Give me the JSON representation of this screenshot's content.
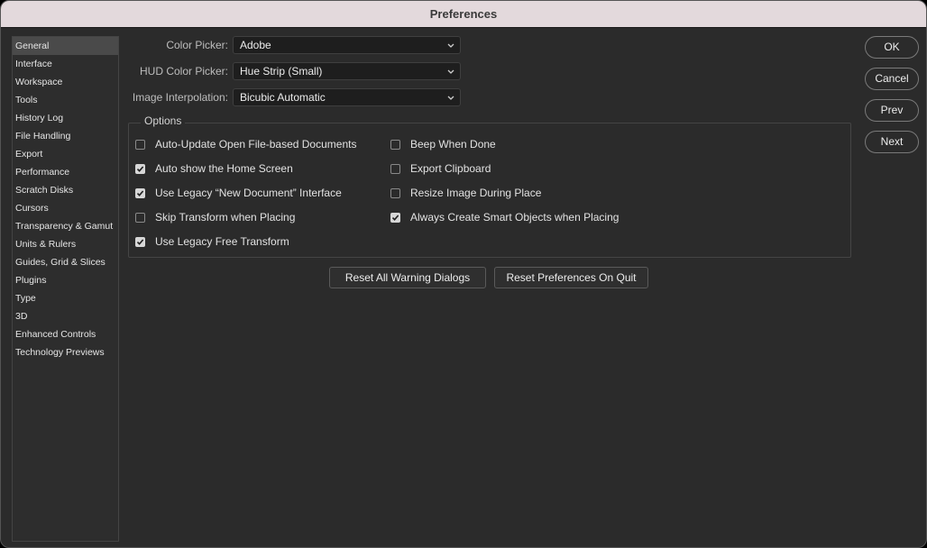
{
  "window": {
    "title": "Preferences"
  },
  "sidebar": {
    "items": [
      {
        "label": "General",
        "selected": true
      },
      {
        "label": "Interface"
      },
      {
        "label": "Workspace"
      },
      {
        "label": "Tools"
      },
      {
        "label": "History Log"
      },
      {
        "label": "File Handling"
      },
      {
        "label": "Export"
      },
      {
        "label": "Performance"
      },
      {
        "label": "Scratch Disks"
      },
      {
        "label": "Cursors"
      },
      {
        "label": "Transparency & Gamut"
      },
      {
        "label": "Units & Rulers"
      },
      {
        "label": "Guides, Grid & Slices"
      },
      {
        "label": "Plugins"
      },
      {
        "label": "Type"
      },
      {
        "label": "3D"
      },
      {
        "label": "Enhanced Controls"
      },
      {
        "label": "Technology Previews"
      }
    ]
  },
  "fields": {
    "color_picker": {
      "label": "Color Picker:",
      "value": "Adobe"
    },
    "hud_color_picker": {
      "label": "HUD Color Picker:",
      "value": "Hue Strip (Small)"
    },
    "image_interpolation": {
      "label": "Image Interpolation:",
      "value": "Bicubic Automatic"
    }
  },
  "options": {
    "title": "Options",
    "left": [
      {
        "label": "Auto-Update Open File-based Documents",
        "checked": false
      },
      {
        "label": "Auto show the Home Screen",
        "checked": true
      },
      {
        "label": "Use Legacy “New Document” Interface",
        "checked": true
      },
      {
        "label": "Skip Transform when Placing",
        "checked": false
      },
      {
        "label": "Use Legacy Free Transform",
        "checked": true
      }
    ],
    "right": [
      {
        "label": "Beep When Done",
        "checked": false
      },
      {
        "label": "Export Clipboard",
        "checked": false
      },
      {
        "label": "Resize Image During Place",
        "checked": false
      },
      {
        "label": "Always Create Smart Objects when Placing",
        "checked": true
      }
    ]
  },
  "buttons": {
    "reset_warnings": "Reset All Warning Dialogs",
    "reset_prefs": "Reset Preferences On Quit",
    "ok": "OK",
    "cancel": "Cancel",
    "prev": "Prev",
    "next": "Next"
  },
  "colors": {
    "background": "#2b2b2b",
    "titlebar": "#e3d9dc",
    "field": "#1e1e1e"
  }
}
